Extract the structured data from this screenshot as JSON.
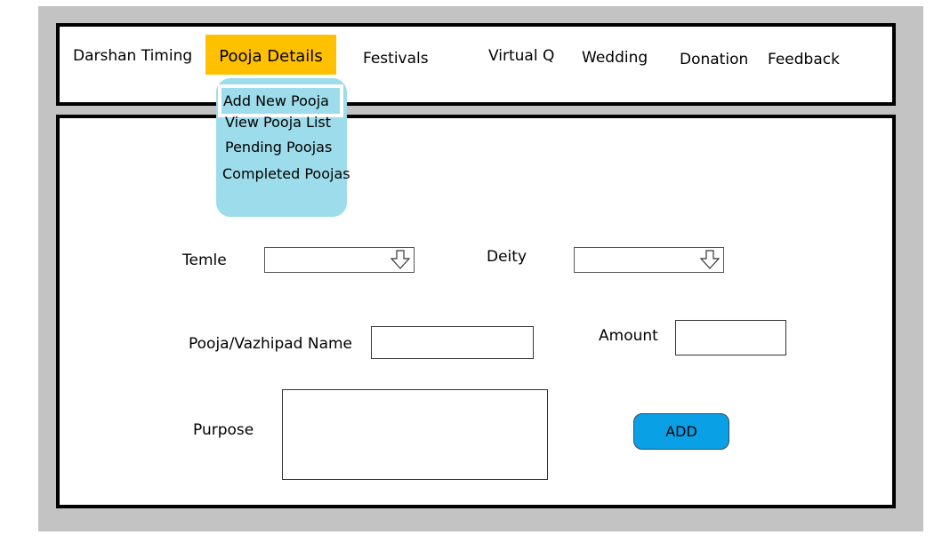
{
  "nav": {
    "items": [
      {
        "label": "Darshan Timing"
      },
      {
        "label": "Pooja Details",
        "active": true
      },
      {
        "label": "Festivals"
      },
      {
        "label": "Virtual Q"
      },
      {
        "label": "Wedding"
      },
      {
        "label": "Donation"
      },
      {
        "label": "Feedback"
      }
    ]
  },
  "dropdown": {
    "items": [
      {
        "label": "Add New Pooja",
        "selected": true
      },
      {
        "label": "View Pooja List"
      },
      {
        "label": "Pending Poojas"
      },
      {
        "label": "Completed Poojas"
      }
    ]
  },
  "form": {
    "temple_label": "Temle",
    "temple_value": "",
    "deity_label": "Deity",
    "deity_value": "",
    "pooja_name_label": "Pooja/Vazhipad Name",
    "pooja_name_value": "",
    "amount_label": "Amount",
    "amount_value": "",
    "purpose_label": "Purpose",
    "purpose_value": "",
    "add_button_label": "ADD"
  },
  "colors": {
    "active_nav": "#ffc000",
    "dropdown_bg": "#9ddcea",
    "add_button": "#0aa0e6",
    "frame_bg": "#c3c3c3"
  },
  "icons": {
    "select_arrow": "hollow-down-arrow-icon"
  }
}
